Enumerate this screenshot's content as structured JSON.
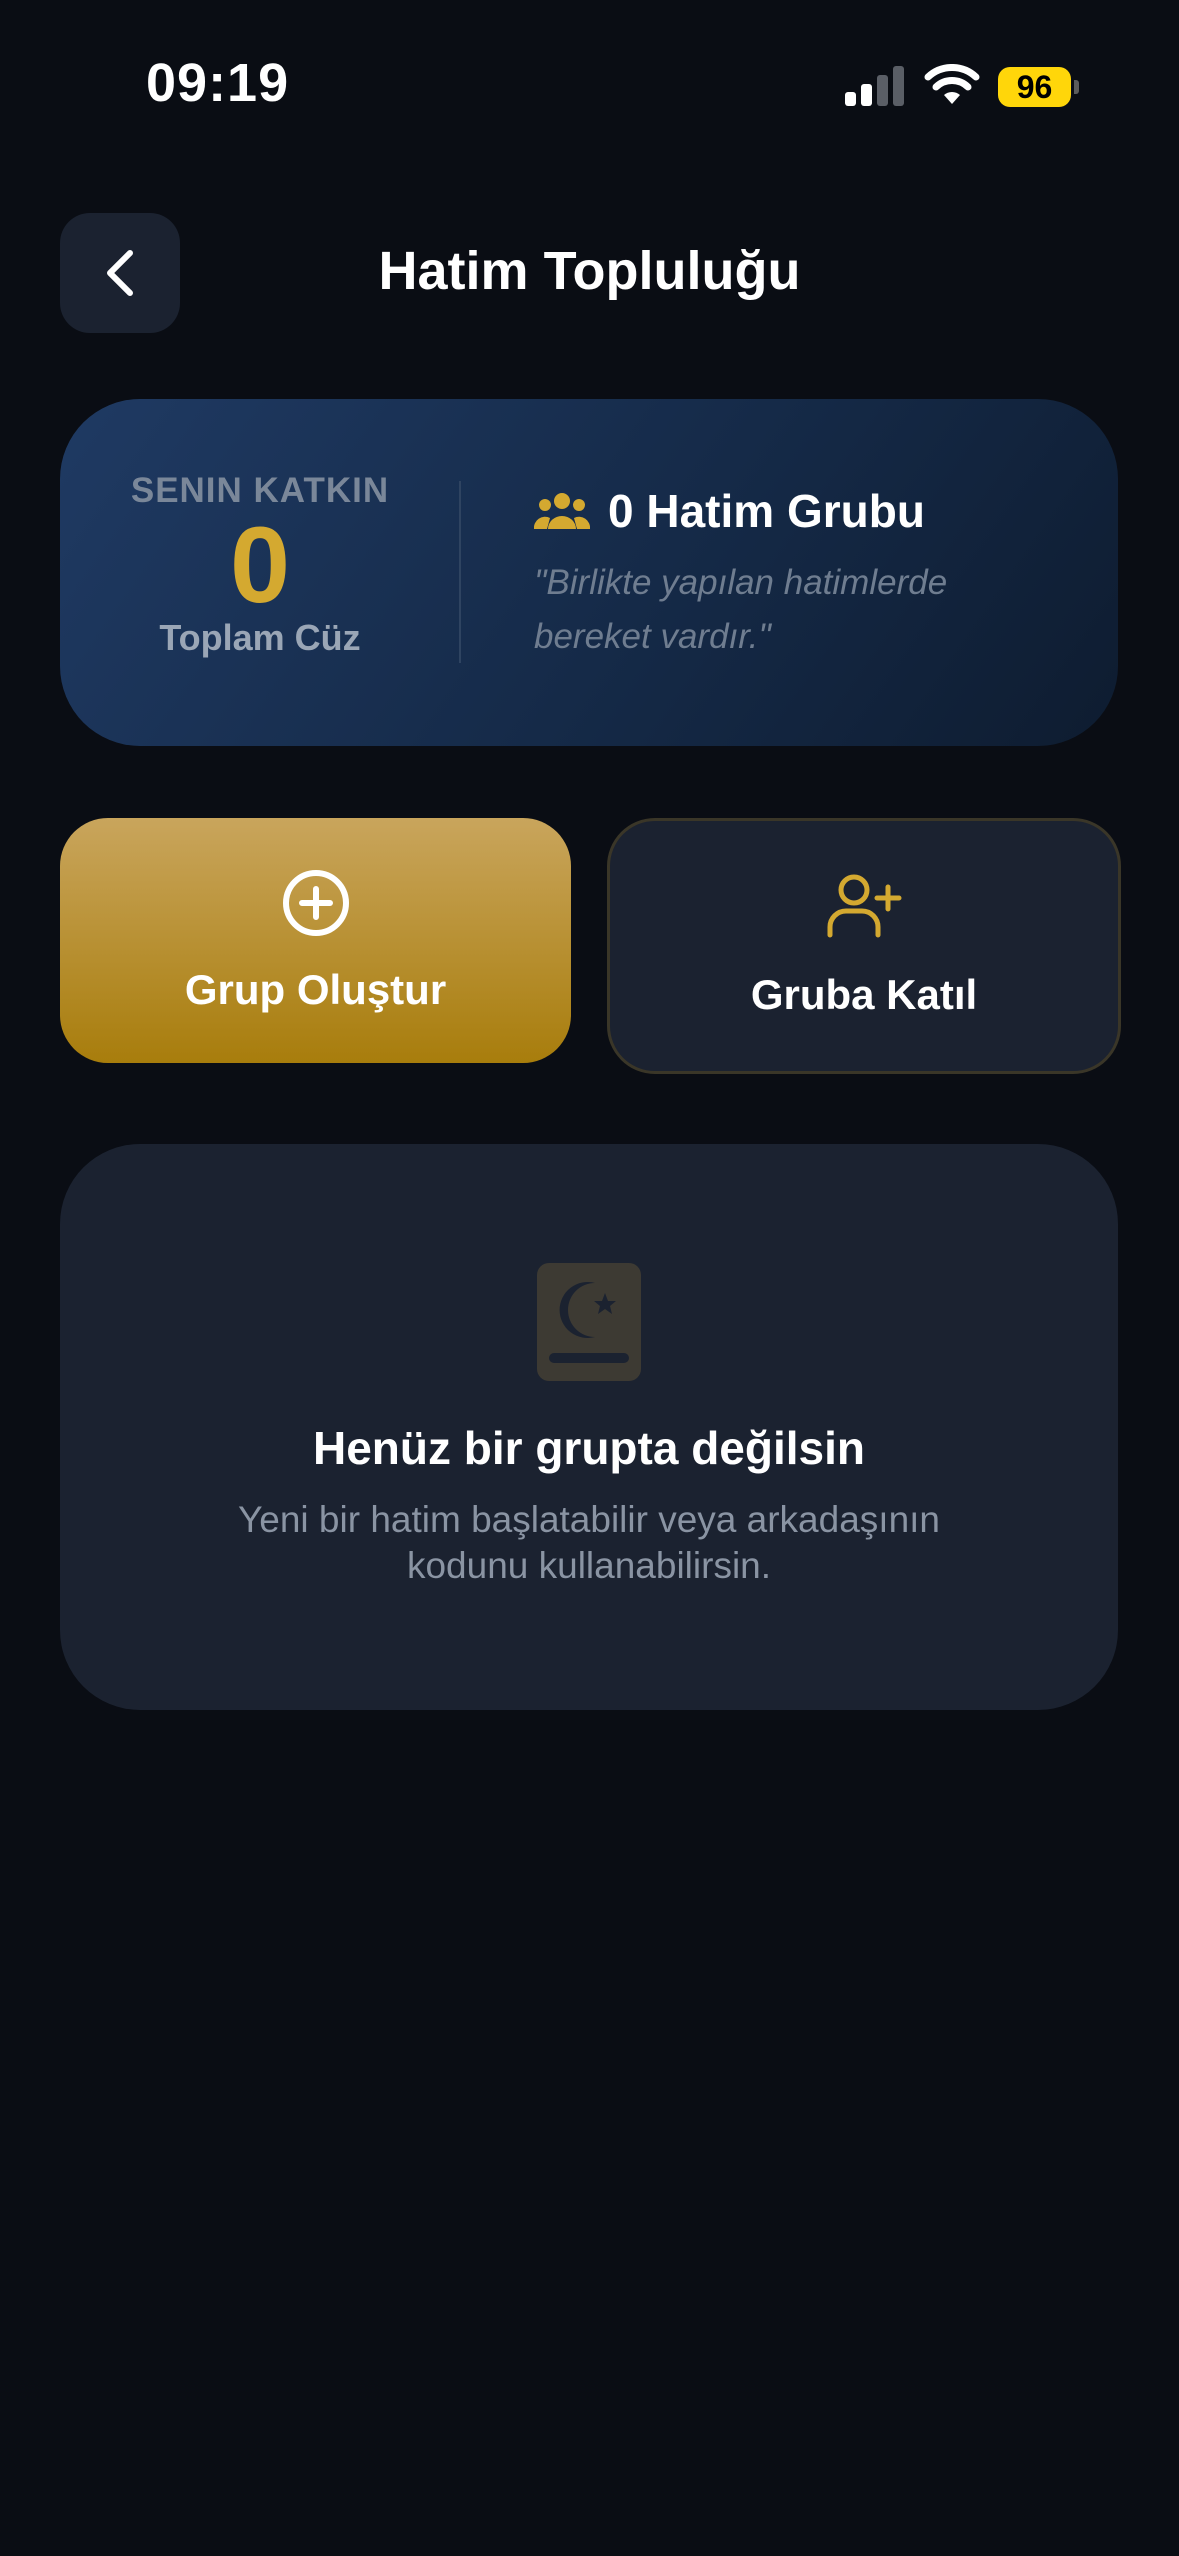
{
  "status_bar": {
    "time": "09:19",
    "battery_level": "96",
    "battery_color": "#ffd60a"
  },
  "header": {
    "back_icon": "chevron-left-icon",
    "title": "Hatim Topluluğu"
  },
  "stats": {
    "contribution_label": "SENIN KATKIN",
    "contribution_value": "0",
    "contribution_unit": "Toplam Cüz",
    "group_icon": "users-icon",
    "group_count_text": "0 Hatim Grubu",
    "quote": "\"Birlikte yapılan hatimlerde bereket vardır.\""
  },
  "actions": {
    "create": {
      "icon": "plus-circle-icon",
      "label": "Grup Oluştur"
    },
    "join": {
      "icon": "user-plus-icon",
      "label": "Gruba Katıl"
    }
  },
  "empty_state": {
    "icon": "quran-book-icon",
    "title": "Henüz bir grupta değilsin",
    "subtitle": "Yeni bir hatim başlatabilir veya arkadaşının kodunu kullanabilirsin."
  },
  "colors": {
    "background": "#0a0d14",
    "accent_gold": "#d4a930",
    "card": "#1b2230"
  }
}
